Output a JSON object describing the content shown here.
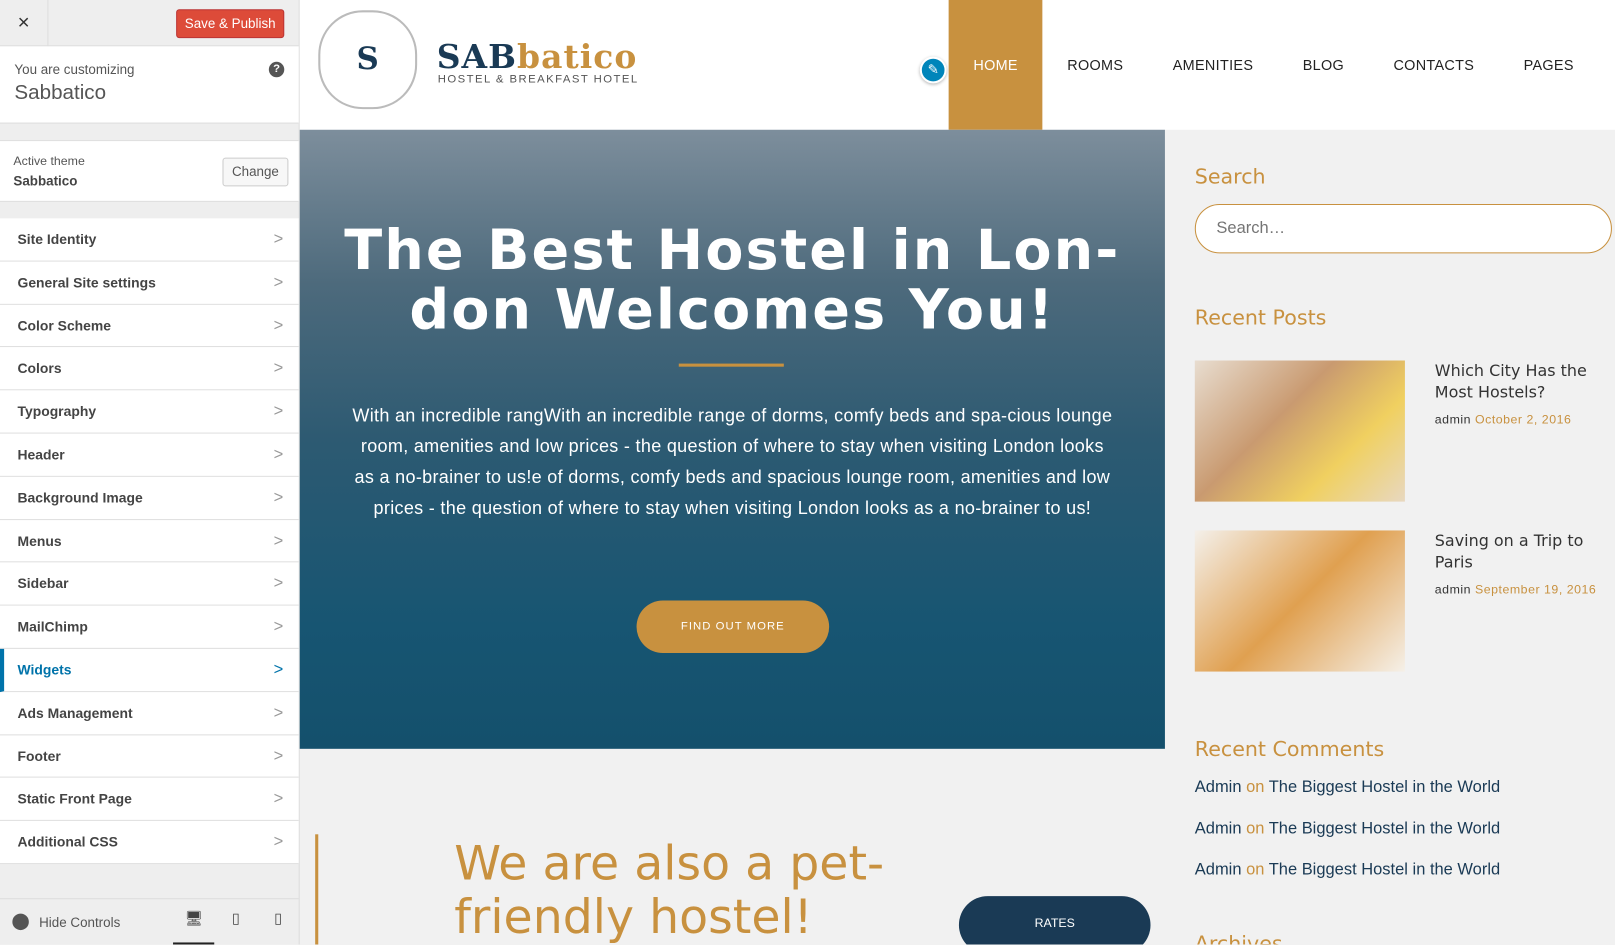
{
  "customizer": {
    "close": "×",
    "save": "Save & Publish",
    "customizing_label": "You are customizing",
    "site_name": "Sabbatico",
    "help": "?",
    "active_theme_label": "Active theme",
    "active_theme": "Sabbatico",
    "change": "Change",
    "menu": [
      {
        "label": "Site Identity"
      },
      {
        "label": "General Site settings"
      },
      {
        "label": "Color Scheme"
      },
      {
        "label": "Colors"
      },
      {
        "label": "Typography"
      },
      {
        "label": "Header"
      },
      {
        "label": "Background Image"
      },
      {
        "label": "Menus"
      },
      {
        "label": "Sidebar"
      },
      {
        "label": "MailChimp"
      },
      {
        "label": "Widgets",
        "active": true
      },
      {
        "label": "Ads Management"
      },
      {
        "label": "Footer"
      },
      {
        "label": "Static Front Page"
      },
      {
        "label": "Additional CSS"
      }
    ],
    "hide_controls": "Hide Controls",
    "devices": [
      "desktop-icon",
      "tablet-icon",
      "mobile-icon"
    ]
  },
  "site": {
    "logo_letter": "S",
    "brand_a": "SAB",
    "brand_b": "batico",
    "tagline": "HOSTEL & BREAKFAST HOTEL",
    "nav": [
      "HOME",
      "ROOMS",
      "AMENITIES",
      "BLOG",
      "CONTACTS",
      "PAGES"
    ],
    "hero": {
      "title": "The Best Hostel in Lon-don Welcomes You!",
      "text": "With an incredible rangWith an incredible range of dorms, comfy beds and spa-cious lounge room, amenities and low prices - the question of where to stay when visiting London looks as a no-brainer to us!e of dorms, comfy beds and spacious lounge room, amenities and low prices - the question of where to stay when visiting London looks as a no-brainer to us!",
      "button": "FIND OUT MORE"
    },
    "pet_title": "We are also a pet-friendly hostel!",
    "rates": "RATES"
  },
  "sidebar": {
    "search_title": "Search",
    "search_placeholder": "Search…",
    "recent_posts_title": "Recent Posts",
    "posts": [
      {
        "title": "Which City Has the Most Hostels?",
        "author": "admin",
        "date": "October 2, 2016"
      },
      {
        "title": "Saving on a Trip to Paris",
        "author": "admin",
        "date": "September 19, 2016"
      }
    ],
    "recent_comments_title": "Recent Comments",
    "comments": [
      {
        "author": "Admin",
        "on": "on",
        "post": "The Biggest Hostel in the World"
      },
      {
        "author": "Admin",
        "on": "on",
        "post": "The Biggest Hostel in the World"
      },
      {
        "author": "Admin",
        "on": "on",
        "post": "The Biggest Hostel in the World"
      }
    ],
    "archives_title": "Archives"
  },
  "colors": {
    "accent": "#c8913f",
    "navy": "#1a3a55",
    "save": "#dd4b39",
    "wp_blue": "#0073aa"
  }
}
